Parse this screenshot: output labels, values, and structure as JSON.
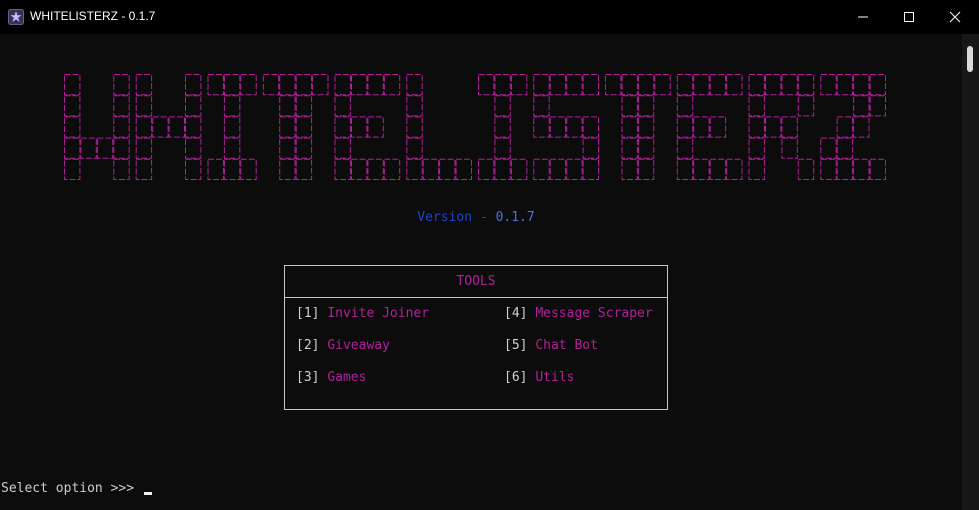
{
  "window": {
    "title": "WHITELISTERZ - 0.1.7",
    "icon": "purple-star-icon"
  },
  "banner": {
    "text": "WHITELISTERZ",
    "color": "#b3209a"
  },
  "version": {
    "label": "Version - ",
    "number": "0.1.7"
  },
  "tools": {
    "title": "TOOLS",
    "items": [
      {
        "key": "[1]",
        "label": "Invite Joiner"
      },
      {
        "key": "[2]",
        "label": "Giveaway"
      },
      {
        "key": "[3]",
        "label": "Games"
      },
      {
        "key": "[4]",
        "label": "Message Scraper"
      },
      {
        "key": "[5]",
        "label": "Chat Bot"
      },
      {
        "key": "[6]",
        "label": "Utils"
      }
    ]
  },
  "prompt": {
    "text": "Select option >>> "
  },
  "colors": {
    "accent": "#b3209a",
    "version_label": "#2244c8",
    "version_number": "#4a70e6",
    "background": "#0c0c0c"
  }
}
